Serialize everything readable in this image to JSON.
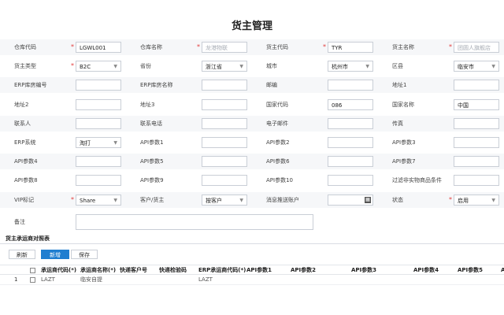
{
  "page": {
    "title": "货主管理"
  },
  "form": {
    "rows": [
      {
        "fields": [
          {
            "label": "仓库代码",
            "required": true,
            "value": "LGWL001",
            "placeholder": false,
            "type": "text"
          },
          {
            "label": "仓库名称",
            "required": true,
            "value": "龙港物联",
            "placeholder": true,
            "type": "text"
          },
          {
            "label": "货主代码",
            "required": true,
            "value": "TYR",
            "placeholder": false,
            "type": "text"
          },
          {
            "label": "货主名称",
            "required": true,
            "value": "团圆人旗舰店",
            "placeholder": true,
            "type": "text"
          }
        ]
      },
      {
        "fields": [
          {
            "label": "货主类型",
            "required": true,
            "value": "B2C",
            "placeholder": false,
            "type": "select"
          },
          {
            "label": "省份",
            "required": false,
            "value": "浙江省",
            "placeholder": false,
            "type": "select"
          },
          {
            "label": "城市",
            "required": false,
            "value": "杭州市",
            "placeholder": false,
            "type": "select"
          },
          {
            "label": "区县",
            "required": false,
            "value": "临安市",
            "placeholder": false,
            "type": "select"
          }
        ]
      },
      {
        "fields": [
          {
            "label": "ERP库房编号",
            "required": false,
            "value": "",
            "placeholder": false,
            "type": "text"
          },
          {
            "label": "ERP库房名称",
            "required": false,
            "value": "",
            "placeholder": false,
            "type": "text"
          },
          {
            "label": "邮编",
            "required": false,
            "value": "",
            "placeholder": false,
            "type": "text"
          },
          {
            "label": "地址1",
            "required": false,
            "value": "",
            "placeholder": false,
            "type": "text"
          }
        ]
      },
      {
        "fields": [
          {
            "label": "地址2",
            "required": false,
            "value": "",
            "placeholder": false,
            "type": "text"
          },
          {
            "label": "地址3",
            "required": false,
            "value": "",
            "placeholder": false,
            "type": "text"
          },
          {
            "label": "国家代码",
            "required": false,
            "value": "086",
            "placeholder": false,
            "type": "text"
          },
          {
            "label": "国家名称",
            "required": false,
            "value": "中国",
            "placeholder": false,
            "type": "text"
          }
        ]
      },
      {
        "fields": [
          {
            "label": "联系人",
            "required": false,
            "value": "",
            "placeholder": false,
            "type": "text"
          },
          {
            "label": "联系电话",
            "required": false,
            "value": "",
            "placeholder": false,
            "type": "text"
          },
          {
            "label": "电子邮件",
            "required": false,
            "value": "",
            "placeholder": false,
            "type": "text"
          },
          {
            "label": "传真",
            "required": false,
            "value": "",
            "placeholder": false,
            "type": "text"
          }
        ]
      },
      {
        "fields": [
          {
            "label": "ERP系统",
            "required": false,
            "value": "淘打",
            "placeholder": false,
            "type": "select"
          },
          {
            "label": "API参数1",
            "required": false,
            "value": "",
            "placeholder": false,
            "type": "text"
          },
          {
            "label": "API参数2",
            "required": false,
            "value": "",
            "placeholder": false,
            "type": "text"
          },
          {
            "label": "API参数3",
            "required": false,
            "value": "",
            "placeholder": false,
            "type": "text"
          }
        ]
      },
      {
        "fields": [
          {
            "label": "API参数4",
            "required": false,
            "value": "",
            "placeholder": false,
            "type": "text"
          },
          {
            "label": "API参数5",
            "required": false,
            "value": "",
            "placeholder": false,
            "type": "text"
          },
          {
            "label": "API参数6",
            "required": false,
            "value": "",
            "placeholder": false,
            "type": "text"
          },
          {
            "label": "API参数7",
            "required": false,
            "value": "",
            "placeholder": false,
            "type": "text"
          }
        ]
      },
      {
        "fields": [
          {
            "label": "API参数8",
            "required": false,
            "value": "",
            "placeholder": false,
            "type": "text"
          },
          {
            "label": "API参数9",
            "required": false,
            "value": "",
            "placeholder": false,
            "type": "text"
          },
          {
            "label": "API参数10",
            "required": false,
            "value": "",
            "placeholder": false,
            "type": "text"
          },
          {
            "label": "过滤非实物商品条件",
            "required": false,
            "value": "",
            "placeholder": false,
            "type": "text"
          }
        ]
      },
      {
        "fields": [
          {
            "label": "VIP标记",
            "required": true,
            "value": "Share",
            "placeholder": false,
            "type": "select"
          },
          {
            "label": "客户/货主",
            "required": false,
            "value": "按客户",
            "placeholder": false,
            "type": "select"
          },
          {
            "label": "消息推送账户",
            "required": false,
            "value": "",
            "placeholder": false,
            "type": "date"
          },
          {
            "label": "状态",
            "required": true,
            "value": "启用",
            "placeholder": false,
            "type": "select"
          }
        ]
      }
    ],
    "remark": {
      "label": "备注",
      "value": ""
    }
  },
  "carrier_section": {
    "title": "货主承运商对照表",
    "buttons": {
      "refresh": "刷新",
      "add": "新增",
      "save": "保存"
    },
    "columns": [
      "承运商代码(*)",
      "承运商名称(*)",
      "快递客户号",
      "快递检验码",
      "ERP承运商代码(*)",
      "API参数1",
      "API参数2",
      "API参数3",
      "API参数4",
      "API参数5",
      "A"
    ],
    "rows": [
      {
        "index": "1",
        "cells": [
          "LAZT",
          "临安自提",
          "",
          "",
          "LAZT",
          "",
          "",
          "",
          "",
          "",
          ""
        ]
      }
    ]
  },
  "colors": {
    "accent": "#1f7ed0",
    "required": "#e23c3c"
  }
}
